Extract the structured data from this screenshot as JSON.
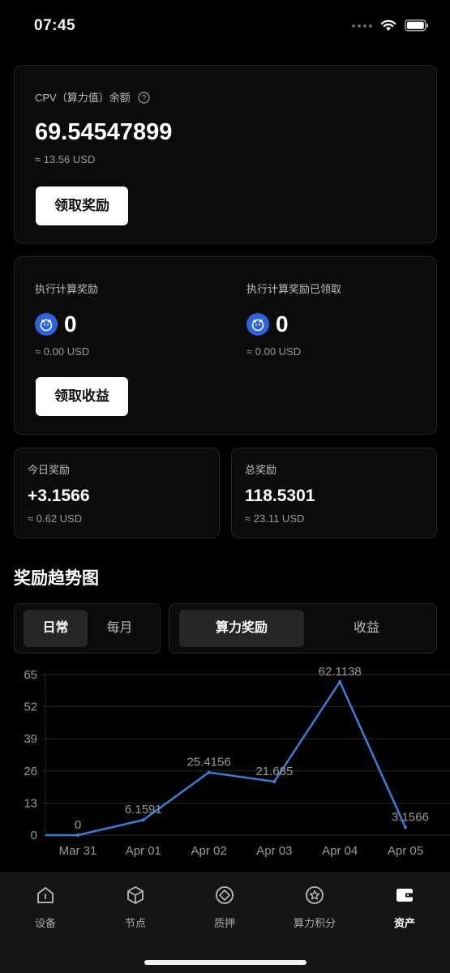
{
  "status": {
    "time": "07:45"
  },
  "balance": {
    "label": "CPV（算力值）余额",
    "value": "69.54547899",
    "usd": "≈ 13.56 USD",
    "button": "领取奖励"
  },
  "execution": {
    "reward_label": "执行计算奖励",
    "reward_value": "0",
    "reward_usd": "≈ 0.00 USD",
    "claimed_label": "执行计算奖励已领取",
    "claimed_value": "0",
    "claimed_usd": "≈ 0.00 USD",
    "button": "领取收益"
  },
  "today": {
    "label": "今日奖励",
    "value": "+3.1566",
    "usd": "≈ 0.62 USD"
  },
  "total": {
    "label": "总奖励",
    "value": "118.5301",
    "usd": "≈ 23.11 USD"
  },
  "trend": {
    "title": "奖励趋势图",
    "period_tabs": [
      {
        "label": "日常"
      },
      {
        "label": "每月"
      }
    ],
    "type_tabs": [
      {
        "label": "算力奖励"
      },
      {
        "label": "收益"
      }
    ],
    "active_period": "日常",
    "active_type": "算力奖励"
  },
  "chart_data": {
    "type": "line",
    "categories": [
      "Mar 31",
      "Apr 01",
      "Apr 02",
      "Apr 03",
      "Apr 04",
      "Apr 05"
    ],
    "series": [
      {
        "values": [
          0,
          6.1591,
          25.4156,
          21.685,
          62.1138,
          3.1566
        ]
      }
    ],
    "data_labels": [
      "0",
      "6.1591",
      "25.4156",
      "21.685",
      "62.1138",
      "3.1566"
    ],
    "y_ticks": [
      "0",
      "13",
      "26",
      "39",
      "52",
      "65"
    ],
    "ylim": [
      0,
      65
    ],
    "grid": true,
    "line_color": "#3a7fd6"
  },
  "tabbar": {
    "items": [
      {
        "label": "设备",
        "icon": "device-icon"
      },
      {
        "label": "节点",
        "icon": "cube-icon"
      },
      {
        "label": "质押",
        "icon": "stake-icon"
      },
      {
        "label": "算力积分",
        "icon": "star-badge-icon"
      },
      {
        "label": "资产",
        "icon": "wallet-icon"
      }
    ],
    "active": "资产"
  }
}
